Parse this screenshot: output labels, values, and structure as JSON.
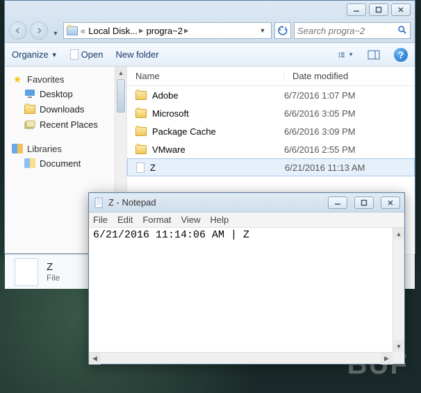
{
  "watermark": "BUF",
  "explorer": {
    "breadcrumbs": [
      {
        "label": "Local Disk...",
        "truncated": true
      },
      {
        "label": "progra~2"
      }
    ],
    "search_placeholder": "Search progra~2",
    "toolbar": {
      "organize": "Organize",
      "open": "Open",
      "new_folder": "New folder"
    },
    "sidebar": {
      "favorites": {
        "label": "Favorites",
        "items": [
          {
            "label": "Desktop",
            "icon": "desktop"
          },
          {
            "label": "Downloads",
            "icon": "downloads"
          },
          {
            "label": "Recent Places",
            "icon": "recent"
          }
        ]
      },
      "libraries": {
        "label": "Libraries",
        "items": [
          {
            "label": "Document",
            "icon": "documents"
          }
        ]
      }
    },
    "columns": {
      "name": "Name",
      "date": "Date modified"
    },
    "rows": [
      {
        "name": "Adobe",
        "type": "folder",
        "date": "6/7/2016 1:07 PM"
      },
      {
        "name": "Microsoft",
        "type": "folder",
        "date": "6/6/2016 3:05 PM"
      },
      {
        "name": "Package Cache",
        "type": "folder",
        "date": "6/6/2016 3:09 PM"
      },
      {
        "name": "VMware",
        "type": "folder",
        "date": "6/6/2016 2:55 PM"
      },
      {
        "name": "Z",
        "type": "file",
        "date": "6/21/2016 11:13 AM",
        "selected": true
      }
    ],
    "preview": {
      "name": "Z",
      "type": "File"
    }
  },
  "notepad": {
    "title": "Z - Notepad",
    "menu": [
      "File",
      "Edit",
      "Format",
      "View",
      "Help"
    ],
    "content": "6/21/2016 11:14:06 AM | Z"
  }
}
